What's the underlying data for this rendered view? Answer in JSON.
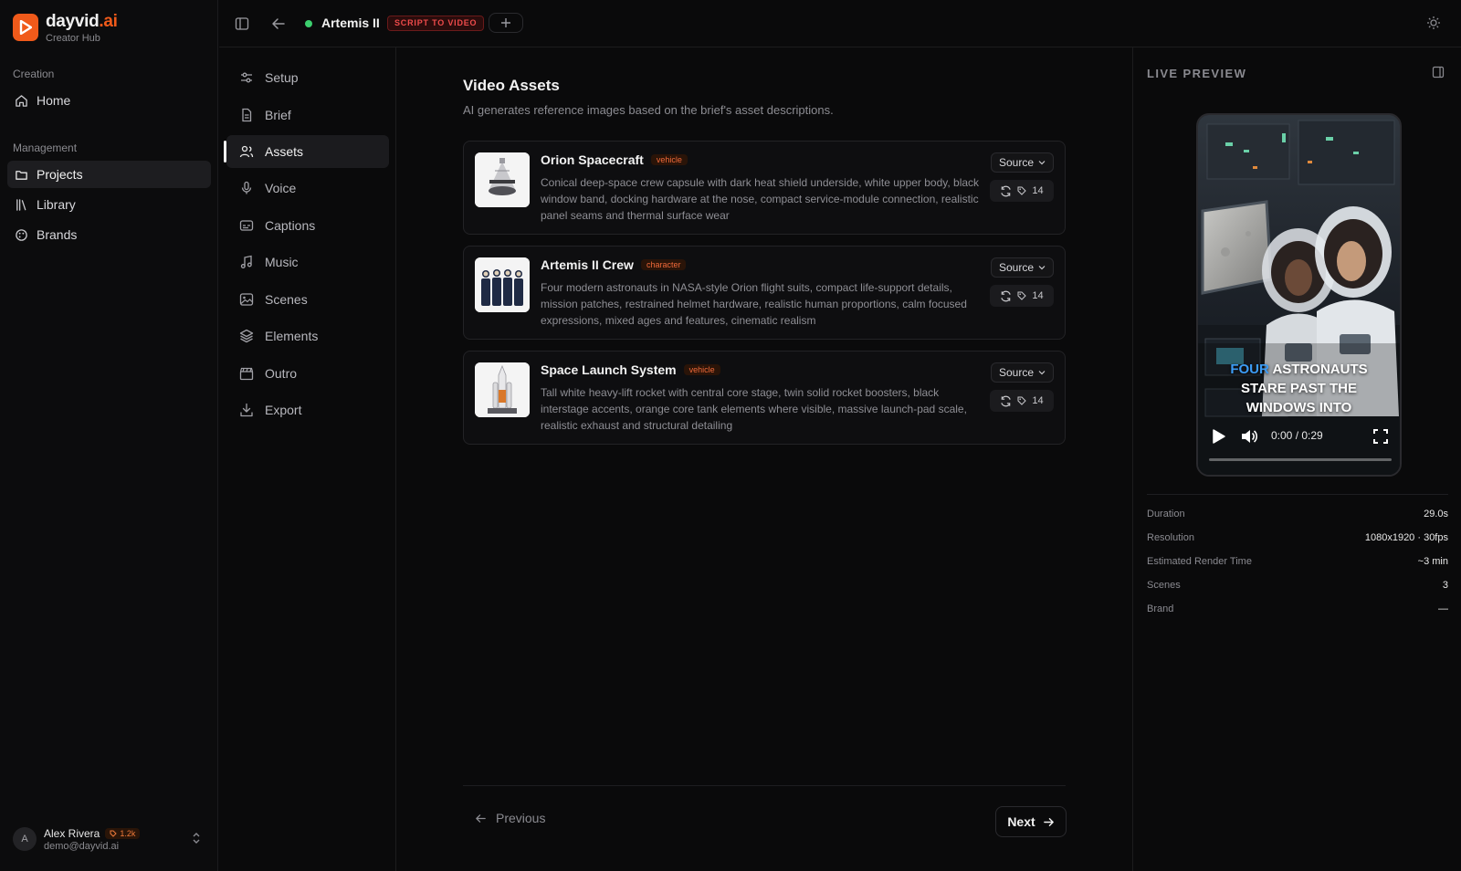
{
  "app": {
    "name_part1": "dayvid",
    "name_part2": ".ai",
    "subtitle": "Creator Hub"
  },
  "sidebar": {
    "creation_label": "Creation",
    "management_label": "Management",
    "home": "Home",
    "projects": "Projects",
    "library": "Library",
    "brands": "Brands"
  },
  "user": {
    "initial": "A",
    "name": "Alex Rivera",
    "credits": "1.2k",
    "email": "demo@dayvid.ai"
  },
  "topbar": {
    "project_name": "Artemis II",
    "mode": "SCRIPT TO VIDEO",
    "status_color": "#3ccf6e"
  },
  "steps": [
    "Setup",
    "Brief",
    "Assets",
    "Voice",
    "Captions",
    "Music",
    "Scenes",
    "Elements",
    "Outro",
    "Export"
  ],
  "main": {
    "title": "Video Assets",
    "subtitle": "AI generates reference images based on the brief's asset descriptions."
  },
  "assets": [
    {
      "name": "Orion Spacecraft",
      "tag": "vehicle",
      "description": "Conical deep-space crew capsule with dark heat shield underside, white upper body, black window band, docking hardware at the nose, compact service-module connection, realistic panel seams and thermal surface wear",
      "source_label": "Source",
      "count": "14"
    },
    {
      "name": "Artemis II Crew",
      "tag": "character",
      "description": "Four modern astronauts in NASA-style Orion flight suits, compact life-support details, mission patches, restrained helmet hardware, realistic human proportions, calm focused expressions, mixed ages and features, cinematic realism",
      "source_label": "Source",
      "count": "14"
    },
    {
      "name": "Space Launch System",
      "tag": "vehicle",
      "description": "Tall white heavy-lift rocket with central core stage, twin solid rocket boosters, black interstage accents, orange core tank elements where visible, massive launch-pad scale, realistic exhaust and structural detailing",
      "source_label": "Source",
      "count": "14"
    }
  ],
  "nav": {
    "previous": "Previous",
    "next": "Next"
  },
  "preview": {
    "label": "LIVE PREVIEW",
    "caption_highlight": "FOUR",
    "caption_rest_line1": "ASTRONAUTS",
    "caption_line2": "STARE PAST THE",
    "caption_line3": "WINDOWS INTO",
    "time": "0:00 / 0:29",
    "progress": 0.0
  },
  "meta": [
    {
      "key": "Duration",
      "value": "29.0s"
    },
    {
      "key": "Resolution",
      "value": "1080x1920 · 30fps"
    },
    {
      "key": "Estimated Render Time",
      "value": "~3 min"
    },
    {
      "key": "Scenes",
      "value": "3"
    },
    {
      "key": "Brand",
      "value": "—"
    }
  ],
  "colors": {
    "accent": "#f05a1a",
    "badge_red": "#ef4b4b",
    "caption_highlight": "#3c9cf5"
  }
}
